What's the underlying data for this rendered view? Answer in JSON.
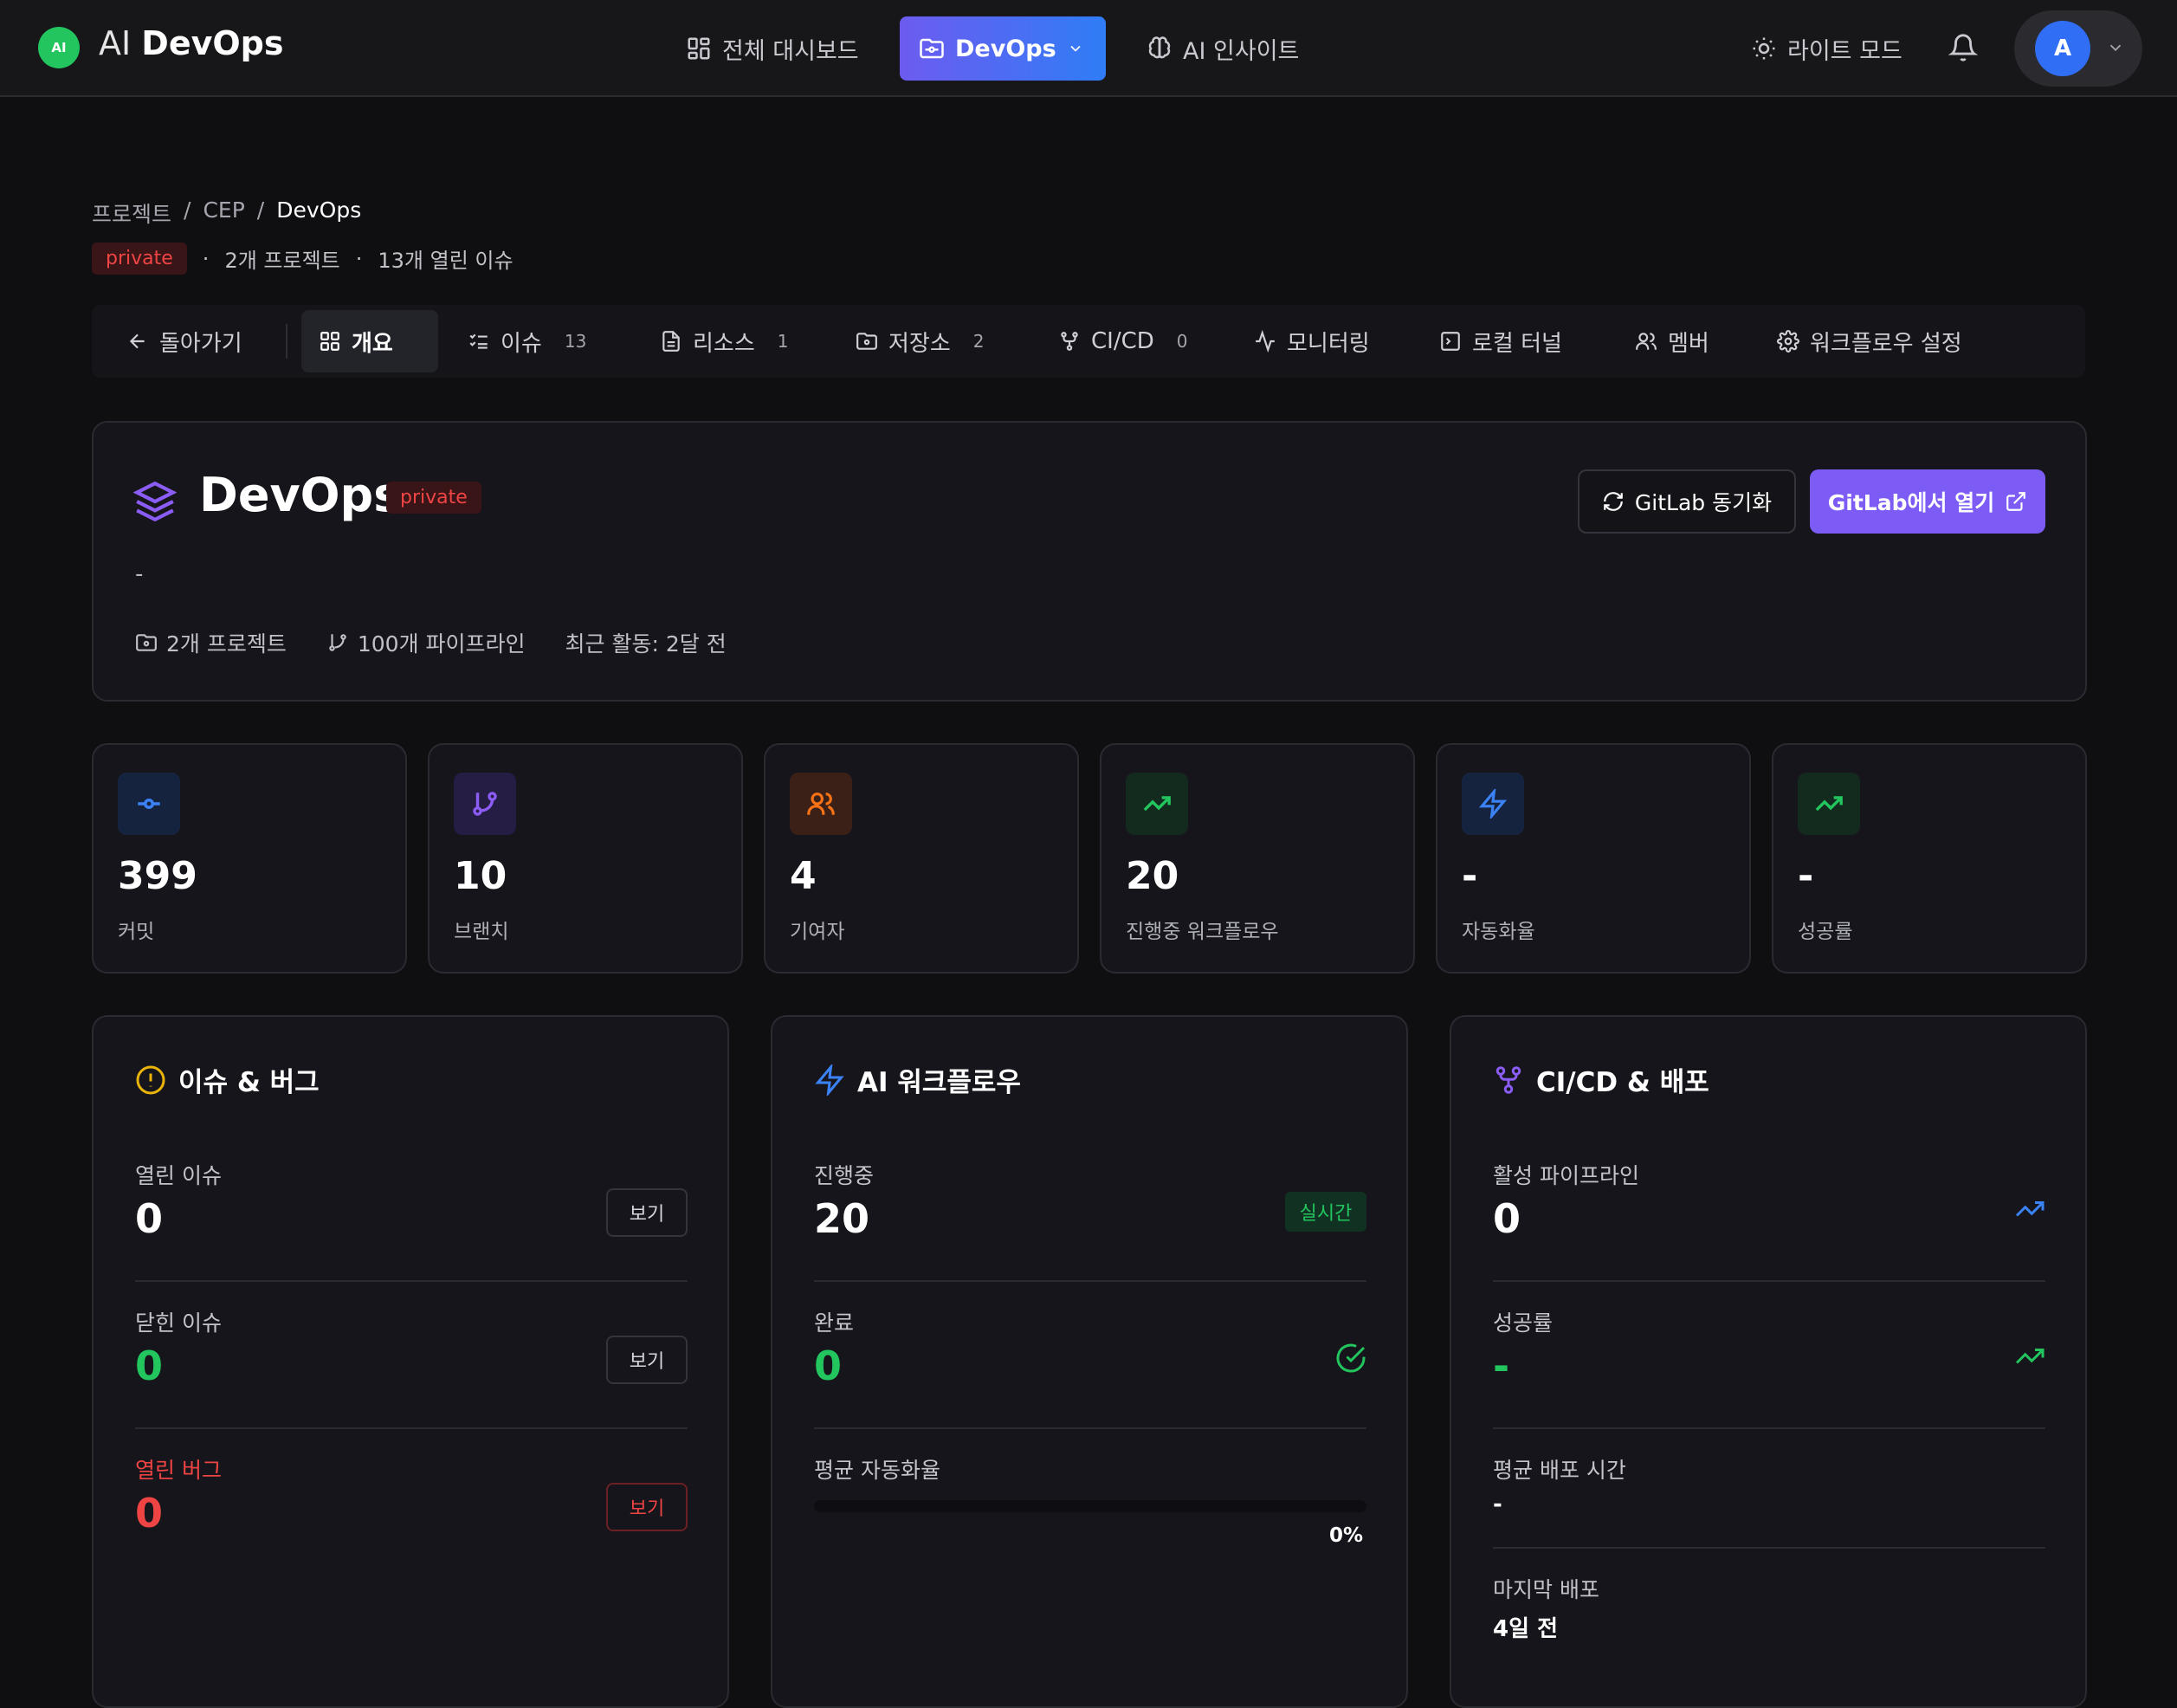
{
  "header": {
    "logo_badge": "AI",
    "logo_prefix": "AI",
    "logo_name": "DevOps",
    "nav": [
      {
        "label": "전체 대시보드",
        "icon": "grid-icon"
      },
      {
        "label": "DevOps",
        "icon": "folder-git-icon"
      },
      {
        "label": "AI 인사이트",
        "icon": "brain-icon"
      }
    ],
    "light_mode_label": "라이트 모드",
    "avatar_initial": "A"
  },
  "breadcrumb": [
    "프로젝트",
    "CEP",
    "DevOps"
  ],
  "breadcrumb_sep": "/",
  "meta": {
    "visibility": "private",
    "dot": "·",
    "projects": "2개 프로젝트",
    "open_issues": "13개 열린 이슈"
  },
  "tabs": {
    "back": "돌아가기",
    "items": [
      {
        "label": "개요",
        "count": ""
      },
      {
        "label": "이슈",
        "count": "13"
      },
      {
        "label": "리소스",
        "count": "1"
      },
      {
        "label": "저장소",
        "count": "2"
      },
      {
        "label": "CI/CD",
        "count": "0"
      },
      {
        "label": "모니터링",
        "count": ""
      },
      {
        "label": "로컬 터널",
        "count": ""
      },
      {
        "label": "멤버",
        "count": ""
      },
      {
        "label": "워크플로우 설정",
        "count": ""
      }
    ]
  },
  "hero": {
    "title": "DevOps",
    "visibility": "private",
    "description": "-",
    "projects": "2개 프로젝트",
    "pipelines": "100개 파이프라인",
    "recent_activity": "최근 활동: 2달 전",
    "sync_button": "GitLab 동기화",
    "open_button": "GitLab에서 열기"
  },
  "stats": [
    {
      "value": "399",
      "label": "커밋",
      "icon": "commit-icon",
      "color": "#3b82f6",
      "bg": "#16233f"
    },
    {
      "value": "10",
      "label": "브랜치",
      "icon": "branch-icon",
      "color": "#8b5cf6",
      "bg": "#261d44"
    },
    {
      "value": "4",
      "label": "기여자",
      "icon": "users-icon",
      "color": "#f97316",
      "bg": "#3a2016"
    },
    {
      "value": "20",
      "label": "진행중 워크플로우",
      "icon": "trending-up-icon",
      "color": "#22c55e",
      "bg": "#132b1e"
    },
    {
      "value": "-",
      "label": "자동화율",
      "icon": "zap-icon",
      "color": "#3b82f6",
      "bg": "#16233f"
    },
    {
      "value": "-",
      "label": "성공률",
      "icon": "trending-up-icon",
      "color": "#22c55e",
      "bg": "#132b1e"
    }
  ],
  "issues_panel": {
    "title": "이슈 & 버그",
    "open_label": "열린 이슈",
    "open_value": "0",
    "closed_label": "닫힌 이슈",
    "closed_value": "0",
    "bugs_label": "열린 버그",
    "bugs_value": "0",
    "view_label": "보기"
  },
  "workflow_panel": {
    "title": "AI 워크플로우",
    "running_label": "진행중",
    "running_value": "20",
    "live_badge": "실시간",
    "done_label": "완료",
    "done_value": "0",
    "avg_label": "평균 자동화율",
    "avg_percent": 0,
    "avg_text": "0%"
  },
  "cicd_panel": {
    "title": "CI/CD & 배포",
    "active_label": "활성 파이프라인",
    "active_value": "0",
    "success_label": "성공률",
    "success_value": "-",
    "avg_time_label": "평균 배포 시간",
    "avg_time_value": "-",
    "last_label": "마지막 배포",
    "last_value": "4일 전"
  },
  "colors": {
    "accent": "#7c5cf5",
    "success": "#22c55e",
    "danger": "#ef4444",
    "warning": "#eab308",
    "info": "#3b82f6"
  }
}
